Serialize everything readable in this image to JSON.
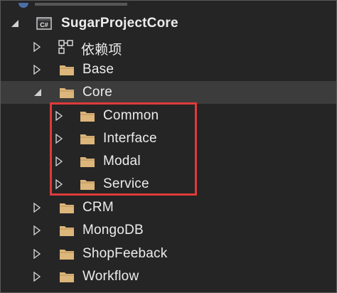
{
  "tree": {
    "project": {
      "label": "SugarProjectCore",
      "icon": "csharp-project-icon",
      "icon_text": "C#"
    },
    "items": [
      {
        "name": "dependencies",
        "label": "依赖项",
        "icon": "dependencies-icon",
        "expanded": false
      },
      {
        "name": "base",
        "label": "Base",
        "icon": "folder-icon",
        "expanded": false
      },
      {
        "name": "core",
        "label": "Core",
        "icon": "folder-icon",
        "expanded": true,
        "selected": true
      },
      {
        "name": "common",
        "label": "Common",
        "icon": "folder-icon",
        "expanded": false
      },
      {
        "name": "interface",
        "label": "Interface",
        "icon": "folder-icon",
        "expanded": false
      },
      {
        "name": "modal",
        "label": "Modal",
        "icon": "folder-icon",
        "expanded": false
      },
      {
        "name": "service",
        "label": "Service",
        "icon": "folder-icon",
        "expanded": false
      },
      {
        "name": "crm",
        "label": "CRM",
        "icon": "folder-icon",
        "expanded": false
      },
      {
        "name": "mongodb",
        "label": "MongoDB",
        "icon": "folder-icon",
        "expanded": false
      },
      {
        "name": "shopfeeback",
        "label": "ShopFeeback",
        "icon": "folder-icon",
        "expanded": false
      },
      {
        "name": "workflow",
        "label": "Workflow",
        "icon": "folder-icon",
        "expanded": false
      }
    ]
  },
  "colors": {
    "background": "#252526",
    "selected_row": "#3c3c3c",
    "folder": "#dcb67a",
    "highlight": "#e03a3a",
    "text": "#ececec"
  }
}
